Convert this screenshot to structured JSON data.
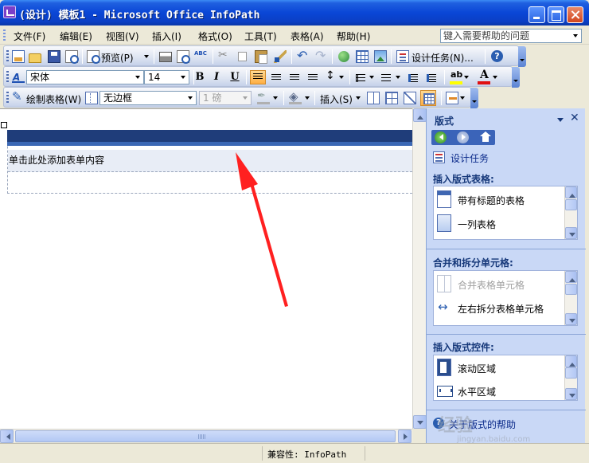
{
  "window": {
    "title": "(设计) 模板1 - Microsoft Office InfoPath"
  },
  "menu": {
    "items": [
      "文件(F)",
      "编辑(E)",
      "视图(V)",
      "插入(I)",
      "格式(O)",
      "工具(T)",
      "表格(A)",
      "帮助(H)"
    ],
    "help_placeholder": "键入需要帮助的问题"
  },
  "toolbar_standard": {
    "preview_label": "预览(P)",
    "design_tasks_label": "设计任务(N)..."
  },
  "toolbar_format": {
    "font_name": "宋体",
    "font_size": "14",
    "bold": "B",
    "italic": "I",
    "underline": "U"
  },
  "toolbar_table": {
    "draw_table_label": "绘制表格(W)",
    "border_style": "无边框",
    "border_weight": "1 磅",
    "insert_label": "插入(S)"
  },
  "canvas": {
    "content_hint": "单击此处添加表单内容",
    "header_color": "#1f3d7a",
    "arrow_color": "#ff2020"
  },
  "taskpane": {
    "title": "版式",
    "design_tasks_link": "设计任务",
    "section_insert_table": {
      "title": "插入版式表格:",
      "items": [
        {
          "label": "带有标题的表格",
          "icon": "titled-table-icon",
          "enabled": true
        },
        {
          "label": "一列表格",
          "icon": "one-column-table-icon",
          "enabled": true
        }
      ]
    },
    "section_merge_split": {
      "title": "合并和拆分单元格:",
      "items": [
        {
          "label": "合并表格单元格",
          "icon": "merge-cells-icon",
          "enabled": false
        },
        {
          "label": "左右拆分表格单元格",
          "icon": "split-cells-icon",
          "enabled": true
        }
      ]
    },
    "section_insert_controls": {
      "title": "插入版式控件:",
      "items": [
        {
          "label": "滚动区域",
          "icon": "scrolling-region-icon",
          "enabled": true
        },
        {
          "label": "水平区域",
          "icon": "horizontal-region-icon",
          "enabled": true
        }
      ]
    },
    "help_link": "关于版式的帮助"
  },
  "statusbar": {
    "compatibility": "兼容性: InfoPath"
  },
  "watermark": {
    "logo": "经验",
    "url": "jingyan.baidu.com"
  }
}
